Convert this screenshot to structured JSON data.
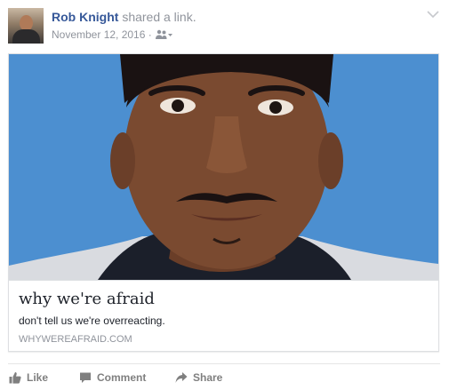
{
  "post": {
    "author": "Rob Knight",
    "action_text": "shared a link.",
    "timestamp": "November 12, 2016",
    "separator": " · ",
    "audience_icon": "friends-icon",
    "menu_icon": "chevron-down-icon"
  },
  "link_card": {
    "title": "why we're afraid",
    "description": "don't tell us we're overreacting.",
    "domain": "WHYWEREAFRAID.COM",
    "image_background": "#4c8fd0"
  },
  "actions": {
    "like_label": "Like",
    "comment_label": "Comment",
    "share_label": "Share"
  },
  "colors": {
    "author_link": "#365899",
    "meta_gray": "#90949c",
    "action_gray": "#7f7f7f"
  }
}
